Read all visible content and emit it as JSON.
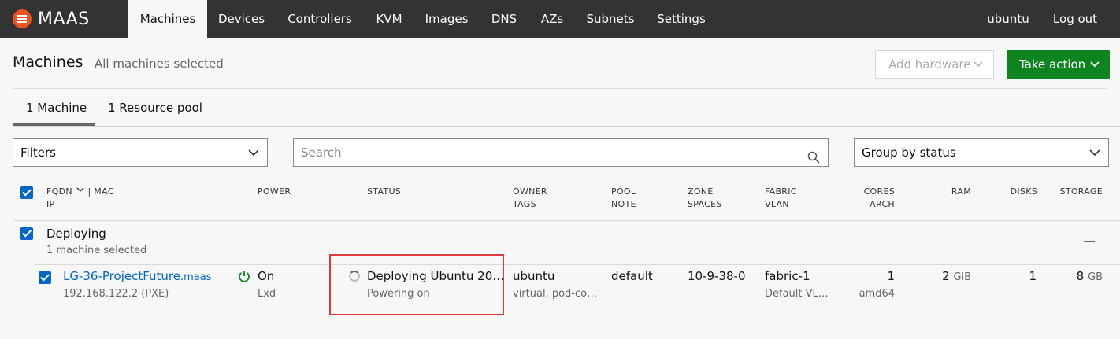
{
  "nav": {
    "logo": "MAAS",
    "items": [
      "Machines",
      "Devices",
      "Controllers",
      "KVM",
      "Images",
      "DNS",
      "AZs",
      "Subnets",
      "Settings"
    ],
    "user": "ubuntu",
    "logout": "Log out"
  },
  "header": {
    "title": "Machines",
    "subtitle": "All machines selected",
    "add_hardware": "Add hardware",
    "take_action": "Take action"
  },
  "tabs": [
    "1 Machine",
    "1 Resource pool"
  ],
  "controls": {
    "filters": "Filters",
    "search_placeholder": "Search",
    "group_by": "Group by status"
  },
  "table": {
    "headers": {
      "fqdn": "FQDN",
      "mac": "| MAC",
      "ip": "IP",
      "power": "POWER",
      "status": "STATUS",
      "owner": "OWNER",
      "tags": "TAGS",
      "pool": "POOL",
      "note": "NOTE",
      "zone": "ZONE",
      "spaces": "SPACES",
      "fabric": "FABRIC",
      "vlan": "VLAN",
      "cores": "CORES",
      "arch": "ARCH",
      "ram": "RAM",
      "disks": "DISKS",
      "storage": "STORAGE"
    },
    "group": {
      "name": "Deploying",
      "sub": "1 machine selected"
    },
    "row": {
      "hostname": "LG-36-ProjectFuture",
      "domain": ".maas",
      "ip": "192.168.122.2 (PXE)",
      "power": "On",
      "power_type": "Lxd",
      "status": "Deploying Ubuntu 20…",
      "status_sub": "Powering on",
      "owner": "ubuntu",
      "tags": "virtual, pod-co…",
      "pool": "default",
      "zone": "10-9-38-0",
      "fabric": "fabric-1",
      "vlan": "Default VL…",
      "cores": "1",
      "arch": "amd64",
      "ram": "2",
      "ram_unit": "GiB",
      "disks": "1",
      "storage": "8",
      "storage_unit": "GB"
    }
  },
  "colors": {
    "nav_bg": "#333333",
    "accent_green": "#0e8420",
    "link_blue": "#0066cc",
    "checkbox_blue": "#0066cc",
    "logo_orange": "#e95420",
    "highlight_red": "#e03a3a"
  }
}
